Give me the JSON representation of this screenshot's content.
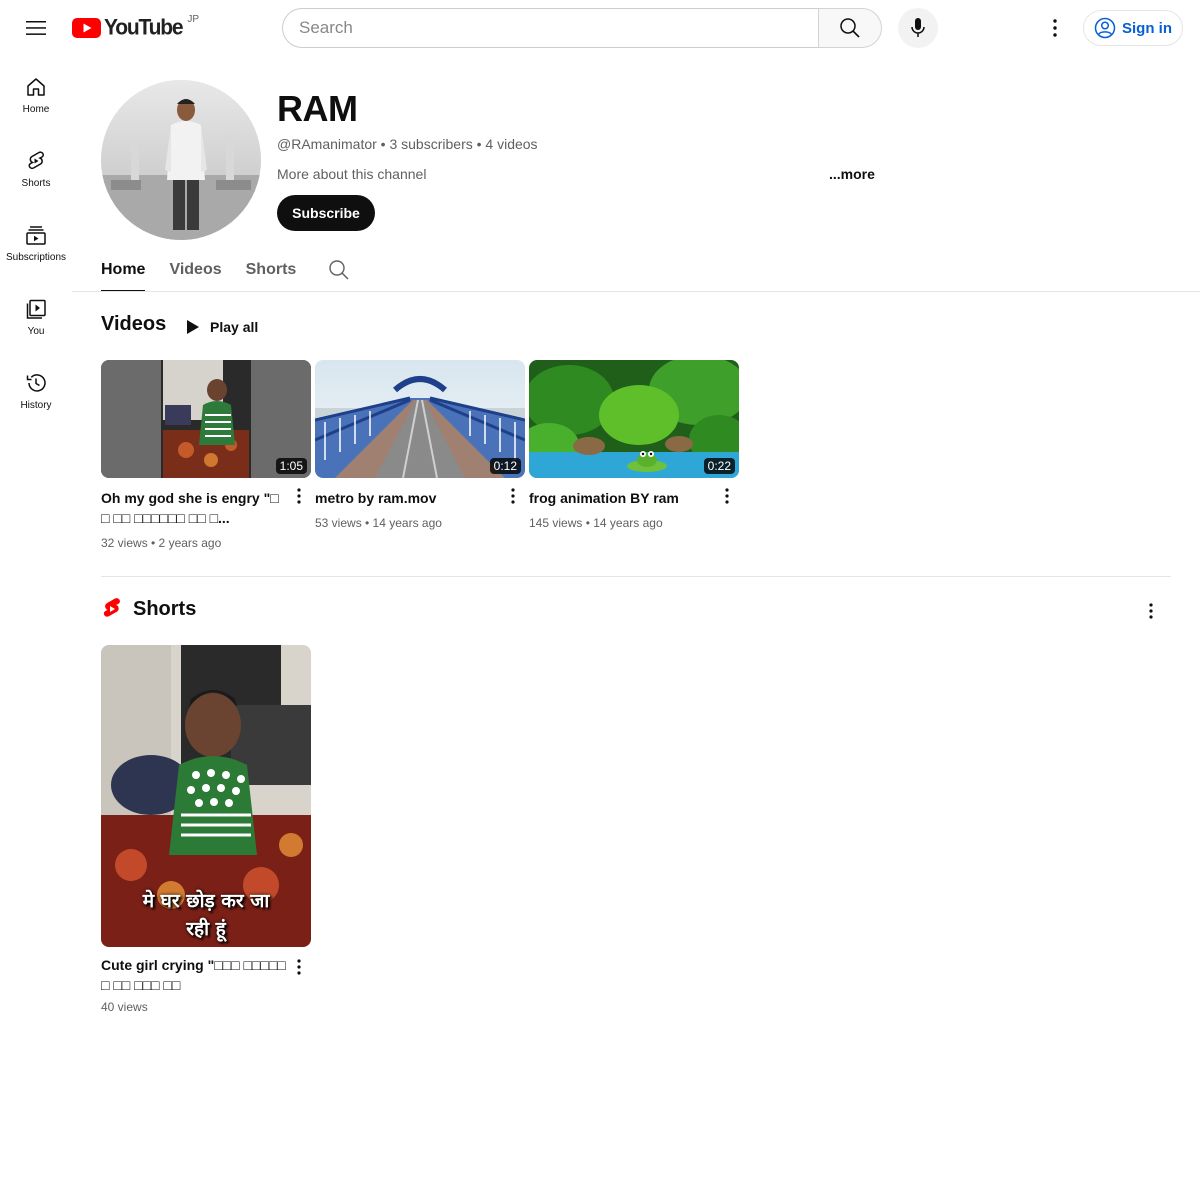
{
  "masthead": {
    "logo_text": "YouTube",
    "country_code": "JP",
    "search_placeholder": "Search",
    "signin_label": "Sign in"
  },
  "guide": {
    "items": [
      {
        "label": "Home",
        "icon": "home-icon"
      },
      {
        "label": "Shorts",
        "icon": "shorts-icon"
      },
      {
        "label": "Subscriptions",
        "icon": "subscriptions-icon"
      },
      {
        "label": "You",
        "icon": "you-icon"
      },
      {
        "label": "History",
        "icon": "history-icon"
      }
    ]
  },
  "channel": {
    "name": "RAM",
    "meta": "@RAmanimator • 3 subscribers • 4 videos",
    "about": "More about this channel",
    "more": "...more",
    "subscribe_label": "Subscribe"
  },
  "tabs": [
    {
      "label": "Home",
      "active": true
    },
    {
      "label": "Videos",
      "active": false
    },
    {
      "label": "Shorts",
      "active": false
    }
  ],
  "videos_shelf": {
    "title": "Videos",
    "play_all": "Play all",
    "items": [
      {
        "title": "Oh my god she is engry \"□□ □□ □□□□□□ □□ □...",
        "meta": "32 views • 2 years ago",
        "duration": "1:05"
      },
      {
        "title": "metro by ram.mov",
        "meta": "53 views • 14 years ago",
        "duration": "0:12"
      },
      {
        "title": "frog animation BY ram",
        "meta": "145 views • 14 years ago",
        "duration": "0:22"
      }
    ]
  },
  "shorts_shelf": {
    "title": "Shorts",
    "items": [
      {
        "title": "Cute girl crying \"□□□ □□□□□□ □□ □□□ □□",
        "meta": "40 views",
        "caption_line1": "मे घर छोड़ कर जा",
        "caption_line2": "रही हूं"
      }
    ]
  },
  "colors": {
    "brand_red": "#ff0000",
    "link_blue": "#065fd4",
    "text_primary": "#0f0f0f",
    "text_secondary": "#606060"
  }
}
